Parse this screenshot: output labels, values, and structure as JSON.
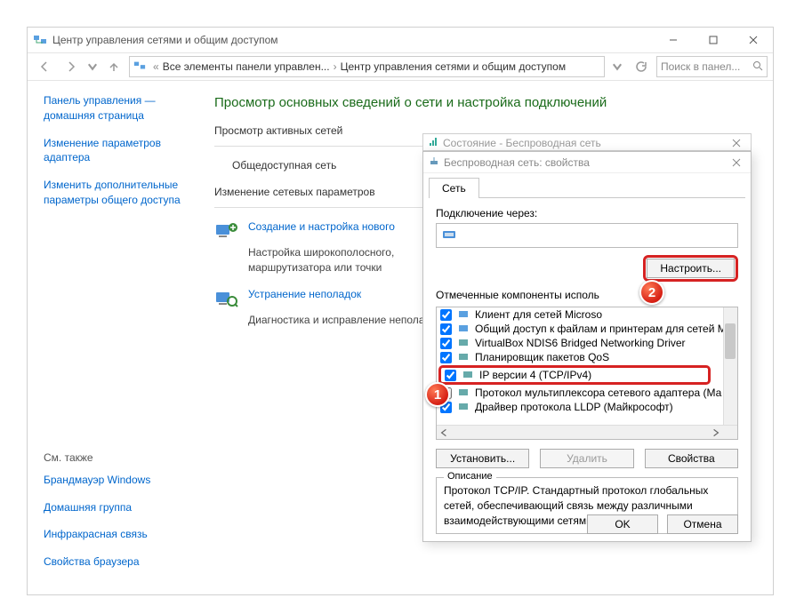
{
  "window": {
    "title": "Центр управления сетями и общим доступом",
    "breadcrumb": {
      "seg1": "Все элементы панели управлен...",
      "seg2": "Центр управления сетями и общим доступом"
    },
    "search_placeholder": "Поиск в панел..."
  },
  "sidebar": {
    "home": "Панель управления — домашняя страница",
    "link1": "Изменение параметров адаптера",
    "link2": "Изменить дополнительные параметры общего доступа",
    "see_also_label": "См. также",
    "see1": "Брандмауэр Windows",
    "see2": "Домашняя группа",
    "see3": "Инфракрасная связь",
    "see4": "Свойства браузера"
  },
  "main": {
    "h1": "Просмотр основных сведений о сети и настройка подключений",
    "active_nets": "Просмотр активных сетей",
    "public_net": "Общедоступная сеть",
    "change_params": "Изменение сетевых параметров",
    "task1_title": "Создание и настройка нового",
    "task1_desc": "Настройка широкополосного, маршрутизатора или точки",
    "task2_title": "Устранение неполадок",
    "task2_desc": "Диагностика и исправление неполадок."
  },
  "status_dlg": {
    "title": "Состояние - Беспроводная сеть"
  },
  "props_dlg": {
    "title": "Беспроводная сеть: свойства",
    "tab": "Сеть",
    "conn_label": "Подключение через:",
    "cfg_btn": "Настроить...",
    "list_label": "Отмеченные компоненты исполь",
    "items": [
      "Клиент для сетей Microso",
      "Общий доступ к файлам и принтерам для сетей Mi",
      "VirtualBox NDIS6 Bridged Networking Driver",
      "Планировщик пакетов QoS",
      "IP версии 4 (TCP/IPv4)",
      "Протокол мультиплексора сетевого адаптера (Ма",
      "Драйвер протокола LLDP (Майкрософт)"
    ],
    "install": "Установить...",
    "remove": "Удалить",
    "properties": "Свойства",
    "desc_legend": "Описание",
    "desc_text": "Протокол TCP/IP. Стандартный протокол глобальных сетей, обеспечивающий связь между различными взаимодействующими сетями.",
    "ok": "OK",
    "cancel": "Отмена"
  },
  "badges": {
    "b1": "1",
    "b2": "2"
  }
}
